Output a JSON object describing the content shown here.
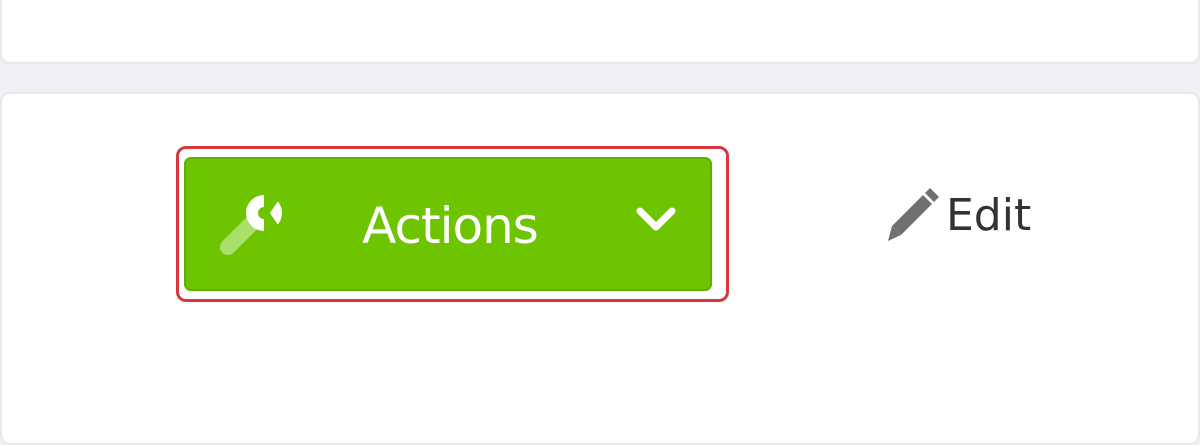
{
  "toolbar": {
    "actions_label": "Actions",
    "actions_icon": "wrench-icon",
    "dropdown_icon": "chevron-down-icon",
    "edit_label": "Edit",
    "edit_icon": "pencil-icon"
  },
  "colors": {
    "actions_background": "#6ec400",
    "highlight_outline": "#d6373d",
    "edit_text": "#333333",
    "page_background": "#eef0f3"
  }
}
